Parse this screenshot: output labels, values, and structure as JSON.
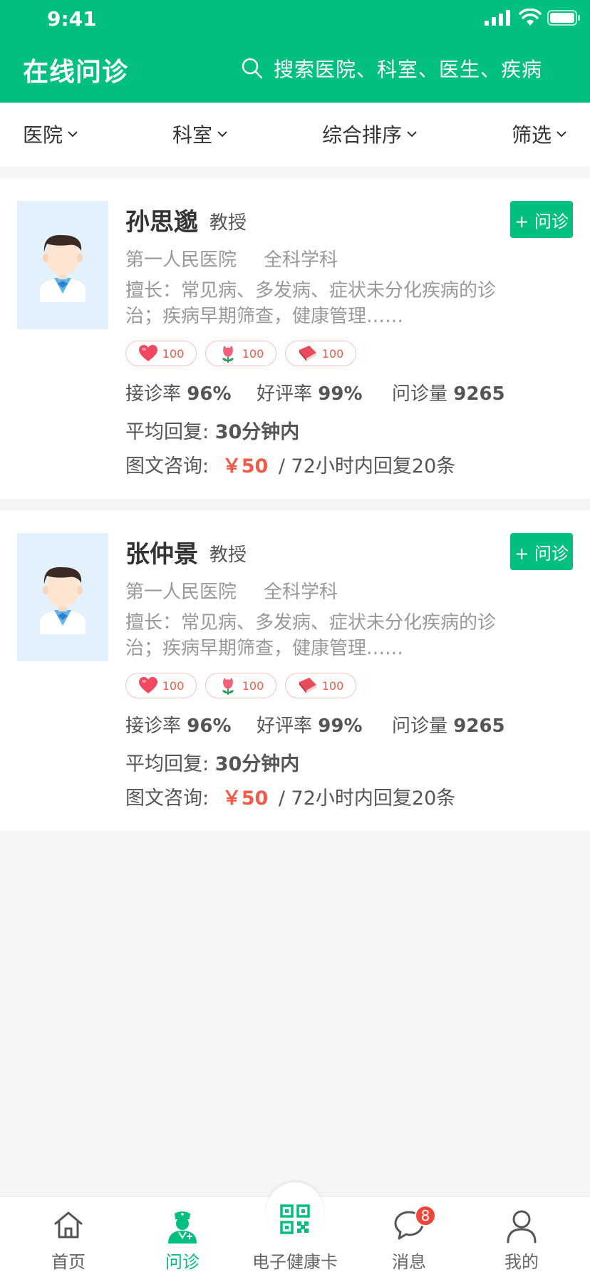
{
  "status_bar": {
    "time": "9:41"
  },
  "header": {
    "title": "在线问诊",
    "search_placeholder": "搜索医院、科室、医生、疾病"
  },
  "filters": [
    "医院",
    "科室",
    "综合排序",
    "筛选"
  ],
  "doctors": [
    {
      "name": "孙思邈",
      "title": "教授",
      "ask_label": "+ 问诊",
      "hospital": "第一人民医院",
      "department": "全科学科",
      "specialty": "擅长：常见病、多发病、症状未分化疾病的诊治；疾病早期筛查，健康管理……",
      "badges": [
        {
          "icon": "heart-icon",
          "count": "100"
        },
        {
          "icon": "flower-icon",
          "count": "100"
        },
        {
          "icon": "book-icon",
          "count": "100"
        }
      ],
      "stats": {
        "accept_label": "接诊率",
        "accept_value": "96%",
        "rating_label": "好评率",
        "rating_value": "99%",
        "volume_label": "问诊量",
        "volume_value": "9265"
      },
      "reply_label": "平均回复:",
      "reply_value": "30分钟内",
      "consult_label": "图文咨询:",
      "price_currency": "￥",
      "price": "50",
      "consult_detail": "/ 72小时内回复20条"
    },
    {
      "name": "张仲景",
      "title": "教授",
      "ask_label": "+ 问诊",
      "hospital": "第一人民医院",
      "department": "全科学科",
      "specialty": "擅长：常见病、多发病、症状未分化疾病的诊治；疾病早期筛查，健康管理……",
      "badges": [
        {
          "icon": "heart-icon",
          "count": "100"
        },
        {
          "icon": "flower-icon",
          "count": "100"
        },
        {
          "icon": "book-icon",
          "count": "100"
        }
      ],
      "stats": {
        "accept_label": "接诊率",
        "accept_value": "96%",
        "rating_label": "好评率",
        "rating_value": "99%",
        "volume_label": "问诊量",
        "volume_value": "9265"
      },
      "reply_label": "平均回复:",
      "reply_value": "30分钟内",
      "consult_label": "图文咨询:",
      "price_currency": "￥",
      "price": "50",
      "consult_detail": "/ 72小时内回复20条"
    }
  ],
  "tabbar": {
    "items": [
      {
        "label": "首页",
        "icon": "home-icon"
      },
      {
        "label": "问诊",
        "icon": "doctor-icon",
        "active": true
      },
      {
        "label": "电子健康卡",
        "icon": "qr-code-icon"
      },
      {
        "label": "消息",
        "icon": "message-icon",
        "badge": "8"
      },
      {
        "label": "我的",
        "icon": "profile-icon"
      }
    ]
  },
  "colors": {
    "brand": "#00bf7f",
    "price": "#f25b4a",
    "avatar_bg": "#e3f1fd",
    "page_bg": "#f5f6f8"
  }
}
